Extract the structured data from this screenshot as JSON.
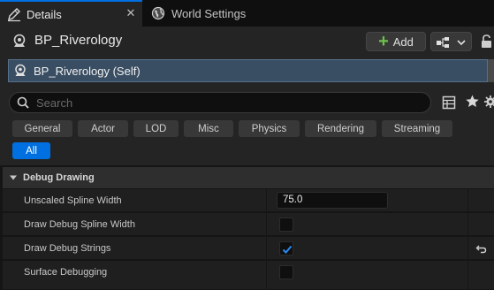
{
  "tabs": {
    "details": {
      "label": "Details",
      "icon": "pencil-icon",
      "close": "✕"
    },
    "world_settings": {
      "label": "World Settings",
      "icon": "globe-icon"
    }
  },
  "header": {
    "title": "BP_Riverology",
    "add_label": "Add",
    "blueprint_button_icon": "blueprint-icon"
  },
  "components": {
    "selected": "BP_Riverology (Self)"
  },
  "search": {
    "placeholder": "Search",
    "value": ""
  },
  "filters": [
    {
      "label": "General",
      "active": false
    },
    {
      "label": "Actor",
      "active": false
    },
    {
      "label": "LOD",
      "active": false
    },
    {
      "label": "Misc",
      "active": false
    },
    {
      "label": "Physics",
      "active": false
    },
    {
      "label": "Rendering",
      "active": false
    },
    {
      "label": "Streaming",
      "active": false
    },
    {
      "label": "All",
      "active": true
    }
  ],
  "category": {
    "label": "Debug Drawing"
  },
  "properties": [
    {
      "name": "Unscaled Spline Width",
      "type": "number",
      "value": "75.0"
    },
    {
      "name": "Draw Debug Spline Width",
      "type": "checkbox",
      "checked": false
    },
    {
      "name": "Draw Debug Strings",
      "type": "checkbox",
      "checked": true
    },
    {
      "name": "Surface Debugging",
      "type": "checkbox",
      "checked": false
    }
  ],
  "colors": {
    "accent": "#0070e0",
    "selection": "#3a4e63",
    "panel": "#242424",
    "add_green": "#6cc24a"
  }
}
